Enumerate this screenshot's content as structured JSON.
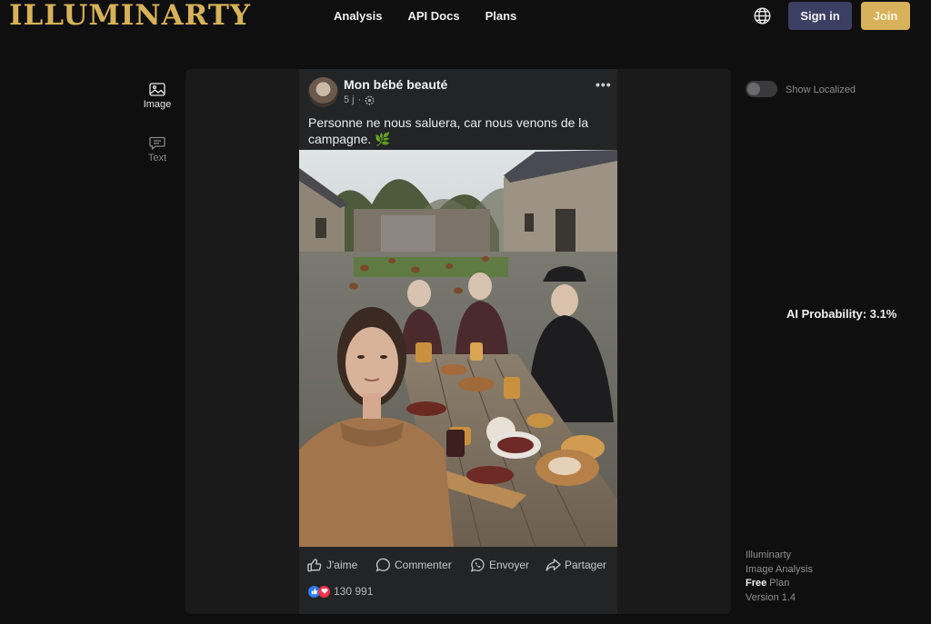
{
  "brand": {
    "logo": "ILLUMINARTY",
    "logo_color": "#d8b25a"
  },
  "nav": {
    "items": [
      "Analysis",
      "API Docs",
      "Plans"
    ]
  },
  "header": {
    "language_icon": "globe-icon",
    "signin_label": "Sign in",
    "join_label": "Join"
  },
  "modes": [
    {
      "label": "Image",
      "icon": "image-icon",
      "active": true
    },
    {
      "label": "Text",
      "icon": "chat-icon",
      "active": false
    }
  ],
  "post": {
    "author": "Mon bébé beauté",
    "time": "5 j",
    "privacy_icon": "globe-gear-icon",
    "caption": "Personne ne nous saluera, car nous venons de la campagne. 🌿",
    "actions": [
      {
        "label": "J'aime",
        "icon": "thumbs-up-icon"
      },
      {
        "label": "Commenter",
        "icon": "comment-icon"
      },
      {
        "label": "Envoyer",
        "icon": "whatsapp-icon"
      },
      {
        "label": "Partager",
        "icon": "share-icon"
      }
    ],
    "reaction_count": "130 991"
  },
  "analysis": {
    "toggle_label": "Show Localized",
    "ai_probability": "AI Probability: 3.1%"
  },
  "footer": {
    "line1": "Illuminarty",
    "line2": "Image Analysis",
    "plan_name": "Free",
    "plan_suffix": " Plan",
    "version": "Version 1.4"
  },
  "colors": {
    "accent": "#d8b25a",
    "signin_bg": "#3b3f63",
    "background": "#0f0f10",
    "panel": "#1a1a1b"
  }
}
